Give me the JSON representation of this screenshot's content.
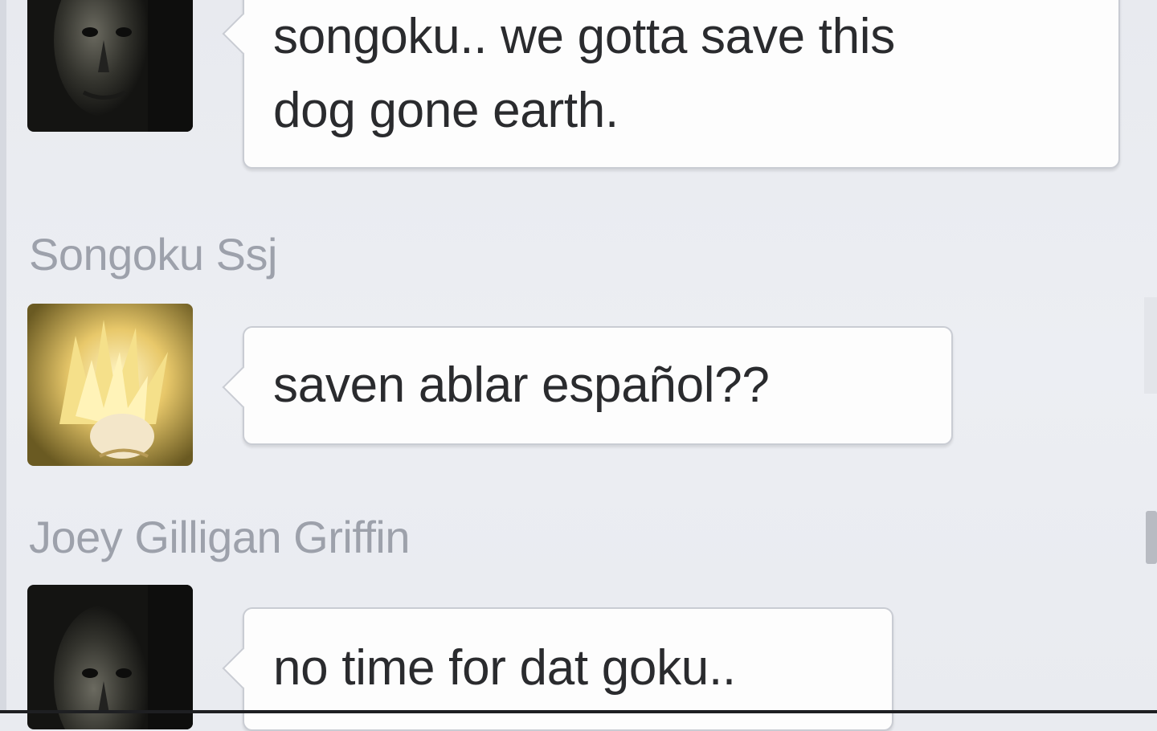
{
  "conversation": {
    "messages": [
      {
        "sender": "",
        "text_lines": [
          "songoku.. we gotta save this",
          "dog gone earth."
        ],
        "avatar": "dark-bald-man-avatar"
      },
      {
        "sender": "Songoku Ssj",
        "text_lines": [
          "saven ablar español??"
        ],
        "avatar": "super-saiyan-goku-avatar"
      },
      {
        "sender": "Joey Gilligan Griffin",
        "text_lines": [
          "no time for dat goku.."
        ],
        "avatar": "dark-bald-man-avatar"
      }
    ]
  },
  "colors": {
    "background": "#e9ebf0",
    "bubble": "#fdfdfd",
    "bubble_border": "#c9ccd3",
    "sender_name": "#9da1ab",
    "message_text": "#2a2b2e"
  }
}
